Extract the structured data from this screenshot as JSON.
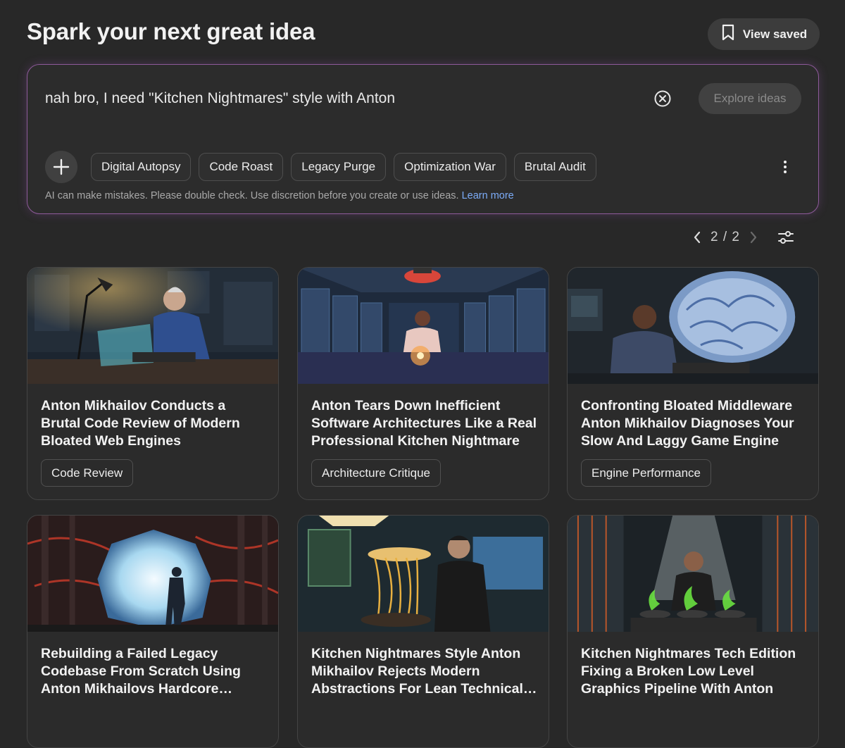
{
  "header": {
    "title": "Spark your next great idea",
    "view_saved_label": "View saved"
  },
  "prompt": {
    "text": "nah bro, I need \"Kitchen Nightmares\" style with Anton",
    "explore_label": "Explore ideas",
    "chips": [
      "Digital Autopsy",
      "Code Roast",
      "Legacy Purge",
      "Optimization War",
      "Brutal Audit"
    ],
    "disclaimer": "AI can make mistakes. Please double check. Use discretion before you create or use ideas.",
    "learn_more": "Learn more"
  },
  "pager": {
    "label": "2 / 2"
  },
  "cards": [
    {
      "title": "Anton Mikhailov Conducts a Brutal Code Review of Modern Bloated Web Engines",
      "tag": "Code Review",
      "image_icon": "programmer-at-desk-illustration"
    },
    {
      "title": "Anton Tears Down Inefficient Software Architectures Like a Real Professional Kitchen Nightmare",
      "tag": "Architecture Critique",
      "image_icon": "chef-in-server-room-illustration"
    },
    {
      "title": "Confronting Bloated Middleware Anton Mikhailov Diagnoses Your Slow And Laggy Game Engine",
      "tag": "Engine Performance",
      "image_icon": "brain-hologram-illustration"
    },
    {
      "title": "Rebuilding a Failed Legacy Codebase From Scratch Using Anton Mikhailovs Hardcore…",
      "image_icon": "portal-wall-illustration"
    },
    {
      "title": "Kitchen Nightmares Style Anton Mikhailov Rejects Modern Abstractions For Lean Technical…",
      "image_icon": "noodle-cook-illustration"
    },
    {
      "title": "Kitchen Nightmares Tech Edition Fixing a Broken Low Level Graphics Pipeline With Anton",
      "image_icon": "green-flame-pots-illustration"
    }
  ],
  "colors": {
    "background": "#282828",
    "prompt_border": "#8e5a9a",
    "link": "#7cacf8"
  }
}
